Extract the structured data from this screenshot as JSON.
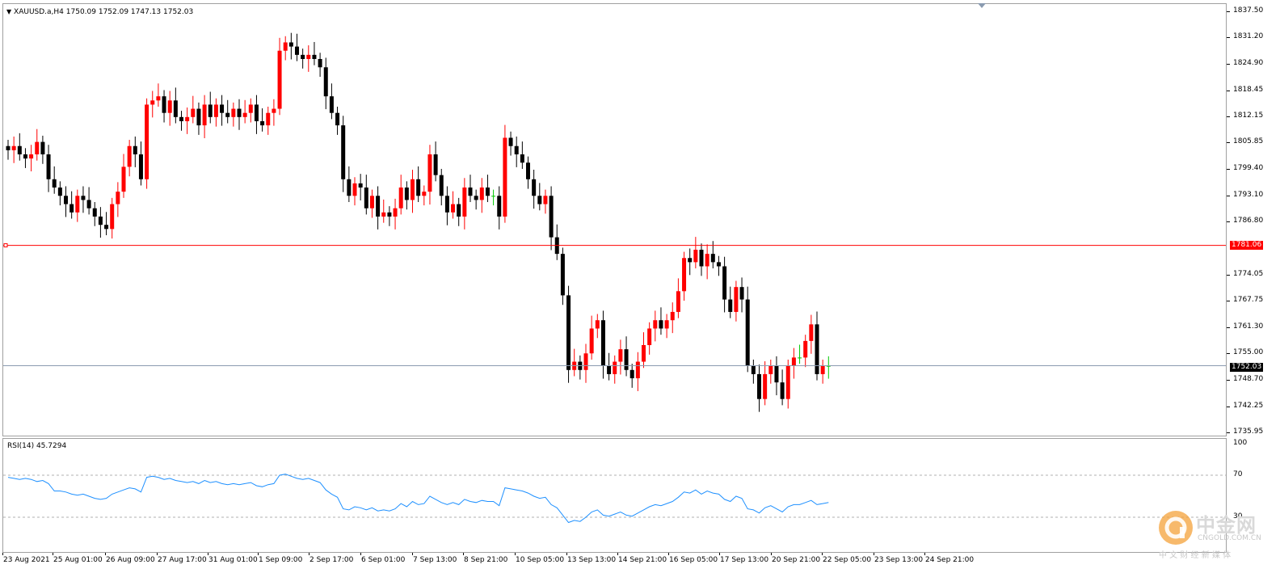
{
  "chart_info": {
    "symbol_line": "XAUUSD.a,H4  1750.09 1752.09 1747.13 1752.03",
    "rsi_label": "RSI(14) 45.7294"
  },
  "price_tags": {
    "support_level": "1781.06",
    "current_price": "1752.03"
  },
  "watermark": {
    "brand": "中金网",
    "domain": "CNGOLD.COM.CN",
    "slogan": "中 文 财 经 新 媒 体"
  },
  "colors": {
    "bull": "#ff0000",
    "bear": "#000000",
    "support_line": "#ff0000",
    "price_line": "#8a9bb0",
    "rsi": "#1e90ff",
    "doji": "#00c800"
  },
  "chart_data": [
    {
      "type": "candlestick",
      "title": "XAUUSD.a,H4",
      "ylim": [
        1735.95,
        1837.5
      ],
      "y_ticks": [
        "1837.50",
        "1831.20",
        "1824.90",
        "1818.45",
        "1812.15",
        "1805.85",
        "1799.40",
        "1793.10",
        "1786.80",
        "1781.06",
        "1774.05",
        "1767.75",
        "1761.30",
        "1755.00",
        "1752.03",
        "1748.70",
        "1742.25",
        "1735.95"
      ],
      "x_ticks": [
        "23 Aug 2021",
        "25 Aug 01:00",
        "26 Aug 09:00",
        "27 Aug 17:00",
        "31 Aug 01:00",
        "1 Sep 09:00",
        "2 Sep 17:00",
        "6 Sep 01:00",
        "7 Sep 13:00",
        "8 Sep 21:00",
        "10 Sep 05:00",
        "13 Sep 13:00",
        "14 Sep 21:00",
        "16 Sep 05:00",
        "17 Sep 13:00",
        "20 Sep 21:00",
        "22 Sep 05:00",
        "23 Sep 13:00",
        "24 Sep 21:00"
      ],
      "ohlc_close": [
        1804,
        1805,
        1803,
        1802,
        1803,
        1806,
        1803,
        1797,
        1795,
        1793,
        1791,
        1789,
        1793,
        1792,
        1790,
        1788,
        1786,
        1785,
        1791,
        1794,
        1800,
        1805,
        1803,
        1797,
        1815,
        1816,
        1817,
        1813,
        1816,
        1812,
        1811,
        1812,
        1814,
        1810,
        1815,
        1812,
        1815,
        1813,
        1812,
        1814,
        1812,
        1813,
        1815,
        1811,
        1810,
        1813,
        1814,
        1828,
        1830,
        1829,
        1827,
        1826,
        1827,
        1826,
        1824,
        1817,
        1813,
        1810,
        1797,
        1793,
        1796,
        1795,
        1790,
        1793,
        1788,
        1789,
        1788,
        1790,
        1795,
        1792,
        1797,
        1793,
        1794,
        1803,
        1798,
        1793,
        1789,
        1791,
        1788,
        1795,
        1793,
        1792,
        1795,
        1793,
        1793,
        1788,
        1807,
        1805,
        1803,
        1801,
        1797,
        1793,
        1791,
        1793,
        1783,
        1779,
        1769,
        1751,
        1753,
        1751,
        1755,
        1761,
        1763,
        1752,
        1750,
        1753,
        1756,
        1751,
        1749,
        1753,
        1757,
        1761,
        1763,
        1761,
        1763,
        1765,
        1770,
        1778,
        1777,
        1780,
        1776,
        1779,
        1777,
        1776,
        1768,
        1765,
        1771,
        1768,
        1752,
        1750,
        1744,
        1750,
        1752,
        1748,
        1744,
        1752,
        1754,
        1754,
        1758,
        1762,
        1750,
        1752,
        1752
      ],
      "tick_size": 1,
      "horizontal_lines": [
        {
          "label": "1781.06",
          "value": 1781.06
        },
        {
          "label": "1752.03",
          "value": 1752.03
        }
      ]
    },
    {
      "type": "line",
      "title": "RSI(14) 45.7294",
      "ylim": [
        0,
        100
      ],
      "y_ticks": [
        "100",
        "70",
        "30"
      ],
      "levels": [
        70,
        30
      ],
      "values": [
        68,
        67,
        66,
        67,
        66,
        64,
        65,
        62,
        55,
        55,
        54,
        52,
        51,
        52,
        50,
        48,
        47,
        48,
        52,
        54,
        56,
        58,
        57,
        54,
        68,
        69,
        68,
        66,
        67,
        65,
        64,
        63,
        64,
        62,
        65,
        63,
        64,
        62,
        61,
        62,
        61,
        62,
        63,
        60,
        59,
        61,
        62,
        70,
        71,
        69,
        67,
        66,
        67,
        65,
        63,
        56,
        52,
        49,
        38,
        37,
        40,
        39,
        37,
        39,
        36,
        37,
        36,
        38,
        43,
        40,
        45,
        42,
        43,
        50,
        47,
        44,
        42,
        44,
        42,
        47,
        45,
        44,
        46,
        45,
        45,
        41,
        58,
        57,
        56,
        55,
        53,
        50,
        48,
        49,
        42,
        39,
        32,
        25,
        27,
        26,
        30,
        35,
        37,
        32,
        31,
        33,
        35,
        32,
        31,
        34,
        37,
        40,
        42,
        41,
        43,
        45,
        49,
        54,
        53,
        56,
        52,
        55,
        53,
        52,
        47,
        45,
        50,
        48,
        38,
        37,
        34,
        39,
        41,
        38,
        35,
        40,
        42,
        42,
        44,
        46,
        42,
        43,
        44
      ]
    }
  ]
}
